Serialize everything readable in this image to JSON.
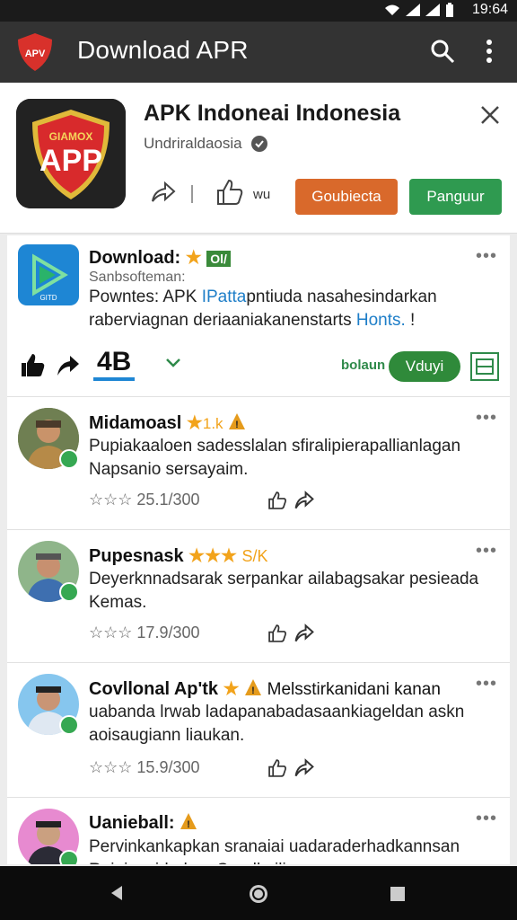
{
  "status_bar": {
    "time": "19:64"
  },
  "appbar": {
    "logo_text": "APV",
    "title": "Download APR"
  },
  "app_header": {
    "icon_small": "GIAMOX",
    "icon_big": "APP",
    "name": "APK Indoneai Indonesia",
    "developer": "Undriraldaosia",
    "like_text": "wu",
    "button_orange": "Goubiecta",
    "button_green": "Panguur"
  },
  "download_card": {
    "title": "Download:",
    "badge": "Ol/",
    "logo_text": "GITD",
    "subtitle": "Sanbsofteman:",
    "text_part1": "Powntes: APK ",
    "text_link1": "IPatta",
    "text_part2": "pntiuda nasahesindarkan raberviagnan deriaaniakanenstarts ",
    "text_link2": "Honts.",
    "text_part3": " !",
    "count": "4B",
    "install_label": "bolaun",
    "install_button": "Vduyi"
  },
  "reviews": [
    {
      "name": "Midamoasl",
      "rating": "1.k",
      "text": "Pupiakaaloen sadesslalan sfiralipierapallianlagan Napsanio sersayaim.",
      "stats": "25.1/300"
    },
    {
      "name": "Pupesnask",
      "rating": "S/K",
      "text": "Deyerknnadsarak serpankar ailabagsakar pesieada Kemas.",
      "stats": "17.9/300"
    },
    {
      "name": "Covllonal Ap'tk",
      "rating": "",
      "text_inline": "Melsstirkanidani kanan",
      "text": "uabanda lrwab ladapanabadasaankiageldan askn aoisaugiann liaukan.",
      "stats": "15.9/300"
    },
    {
      "name": "Uanieball:",
      "rating": "",
      "text": "Pervinkankapkan sranaiai uadaraderhadkannsan Rajaivenidadarg Sandkailis",
      "stats": ""
    }
  ],
  "icons": [
    "wifi-icon",
    "signal-icon",
    "battery-icon",
    "search-icon",
    "more-vert-icon",
    "close-icon",
    "share-icon",
    "thumb-up-icon",
    "star-icon",
    "warning-icon",
    "chevron-down-icon",
    "expand-icon",
    "back-nav-icon",
    "home-nav-icon",
    "recents-nav-icon"
  ],
  "colors": {
    "appbar": "#333333",
    "orange": "#d9692b",
    "green": "#2f9a50",
    "star": "#f2a31b",
    "link": "#1e7ec8"
  }
}
